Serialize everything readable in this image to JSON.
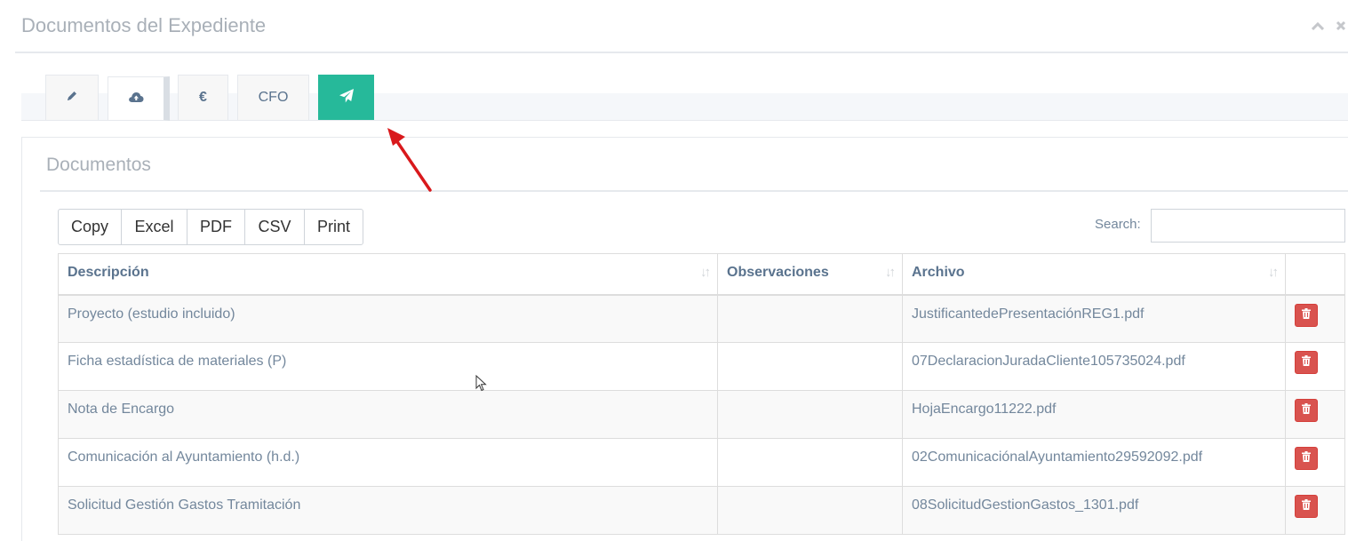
{
  "panel": {
    "title": "Documentos del Expediente",
    "collapse_icon": "chevron-up-icon",
    "close_icon": "close-icon"
  },
  "tabs": [
    {
      "icon": "pencil-icon",
      "label": ""
    },
    {
      "icon": "cloud-upload-icon",
      "label": "",
      "active": true
    },
    {
      "icon": "euro-icon",
      "label": "€"
    },
    {
      "icon": "",
      "label": "CFO"
    },
    {
      "icon": "paper-plane-icon",
      "label": ""
    }
  ],
  "section": {
    "title": "Documentos"
  },
  "toolbar": {
    "copy_label": "Copy",
    "excel_label": "Excel",
    "pdf_label": "PDF",
    "csv_label": "CSV",
    "print_label": "Print"
  },
  "search": {
    "label": "Search:",
    "value": ""
  },
  "table": {
    "headers": [
      "Descripción",
      "Observaciones",
      "Archivo",
      ""
    ],
    "rows": [
      {
        "descripcion": "Proyecto (estudio incluido)",
        "observaciones": "",
        "archivo": "JustificantedePresentaciónREG1.pdf"
      },
      {
        "descripcion": "Ficha estadística de materiales (P)",
        "observaciones": "",
        "archivo": "07DeclaracionJuradaCliente105735024.pdf"
      },
      {
        "descripcion": "Nota de Encargo",
        "observaciones": "",
        "archivo": "HojaEncargo11222.pdf"
      },
      {
        "descripcion": "Comunicación al Ayuntamiento (h.d.)",
        "observaciones": "",
        "archivo": "02ComunicaciónalAyuntamiento29592092.pdf"
      },
      {
        "descripcion": "Solicitud Gestión Gastos Tramitación",
        "observaciones": "",
        "archivo": "08SolicitudGestionGastos_1301.pdf"
      }
    ]
  },
  "colors": {
    "accent_green": "#26b99a",
    "delete_red": "#d9534f",
    "annotation_arrow": "#d9191c"
  }
}
